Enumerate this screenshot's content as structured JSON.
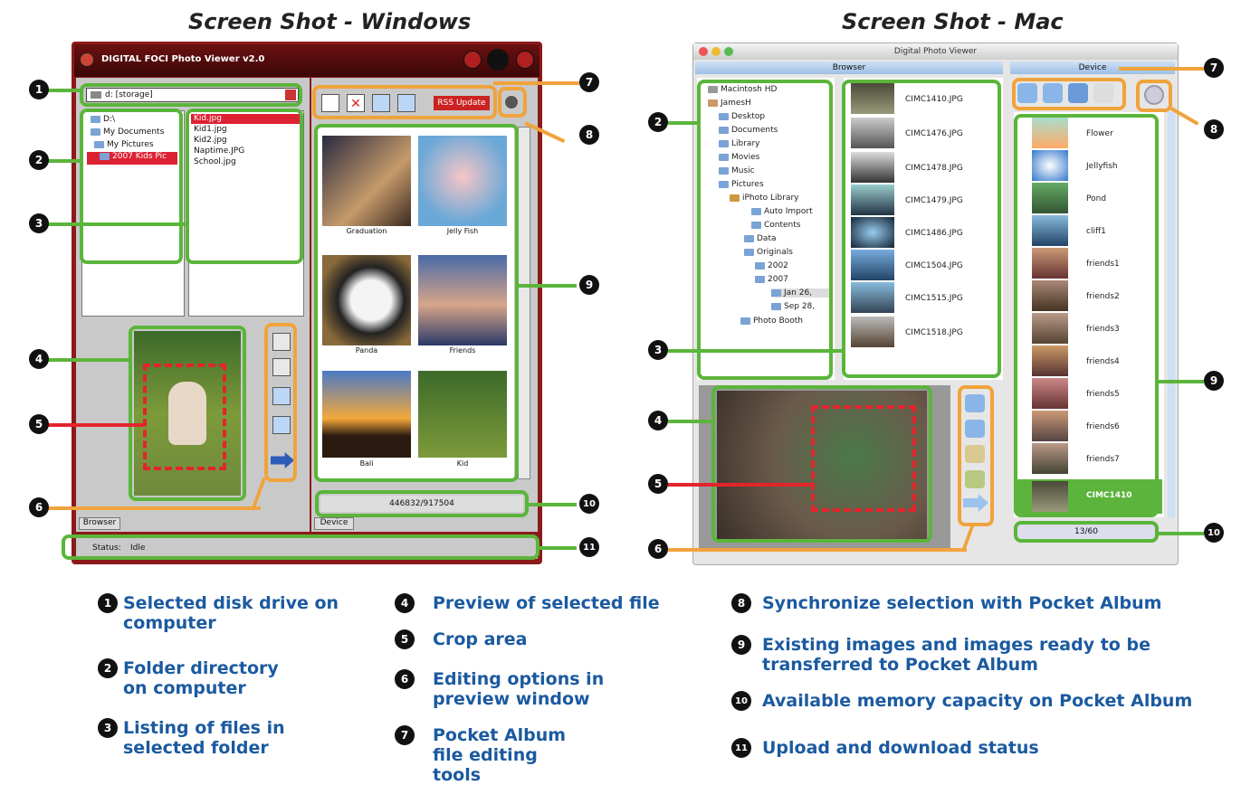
{
  "headings": {
    "windows": "Screen Shot - Windows",
    "mac": "Screen Shot - Mac"
  },
  "windows": {
    "title": "DIGITAL FOCI Photo Viewer v2.0",
    "drive": "d: [storage]",
    "folders": [
      "D:\\",
      "My Documents",
      "My Pictures",
      "2007 Kids Pic"
    ],
    "files": [
      "Kid.jpg",
      "Kid1.jpg",
      "Kid2.jpg",
      "Naptime.JPG",
      "School.jpg"
    ],
    "update_button": "RSS Update",
    "thumbnails": [
      "Graduation",
      "Jelly Fish",
      "Panda",
      "Friends",
      "Bali",
      "Kid"
    ],
    "memory": "446832/917504",
    "tab_browser": "Browser",
    "tab_device": "Device",
    "status_label": "Status:",
    "status_value": "Idle"
  },
  "mac": {
    "title": "Digital Photo Viewer",
    "browser_header": "Browser",
    "device_header": "Device",
    "tree": [
      "Macintosh HD",
      "JamesH",
      "Desktop",
      "Documents",
      "Library",
      "Movies",
      "Music",
      "Pictures",
      "iPhoto Library",
      "Auto Import",
      "Contents",
      "Data",
      "Originals",
      "2002",
      "2007",
      "Jan 26,",
      "Sep 28,",
      "Photo Booth"
    ],
    "files": [
      "CIMC1410.JPG",
      "CIMC1476.JPG",
      "CIMC1478.JPG",
      "CIMC1479.JPG",
      "CIMC1486.JPG",
      "CIMC1504.JPG",
      "CIMC1515.JPG",
      "CIMC1518.JPG"
    ],
    "device_items": [
      "Flower",
      "Jellyfish",
      "Pond",
      "cliff1",
      "friends1",
      "friends2",
      "friends3",
      "friends4",
      "friends5",
      "friends6",
      "friends7",
      "CIMC1410"
    ],
    "memory": "13/60"
  },
  "legend": [
    {
      "num": "1",
      "text": "Selected disk drive on computer"
    },
    {
      "num": "2",
      "text": "Folder directory on computer"
    },
    {
      "num": "3",
      "text": "Listing of files in selected folder"
    },
    {
      "num": "4",
      "text": "Preview of selected file"
    },
    {
      "num": "5",
      "text": "Crop area"
    },
    {
      "num": "6",
      "text": "Editing options in preview window"
    },
    {
      "num": "7",
      "text": "Pocket Album file editing tools"
    },
    {
      "num": "8",
      "text": "Synchronize selection with Pocket Album"
    },
    {
      "num": "9",
      "text": "Existing images and images ready to be transferred to Pocket Album"
    },
    {
      "num": "10",
      "text": "Available memory capacity on Pocket Album"
    },
    {
      "num": "11",
      "text": "Upload and download status"
    }
  ],
  "callouts": {
    "c1": "1",
    "c2": "2",
    "c3": "3",
    "c4": "4",
    "c5": "5",
    "c6": "6",
    "c7": "7",
    "c8": "8",
    "c9": "9",
    "c10": "10",
    "c11": "11"
  },
  "colors": {
    "green": "#5bb53a",
    "orange": "#f0a33c",
    "red": "#e3242b",
    "legend_text": "#1b5aa0",
    "win_frame": "#8b1a1a"
  }
}
